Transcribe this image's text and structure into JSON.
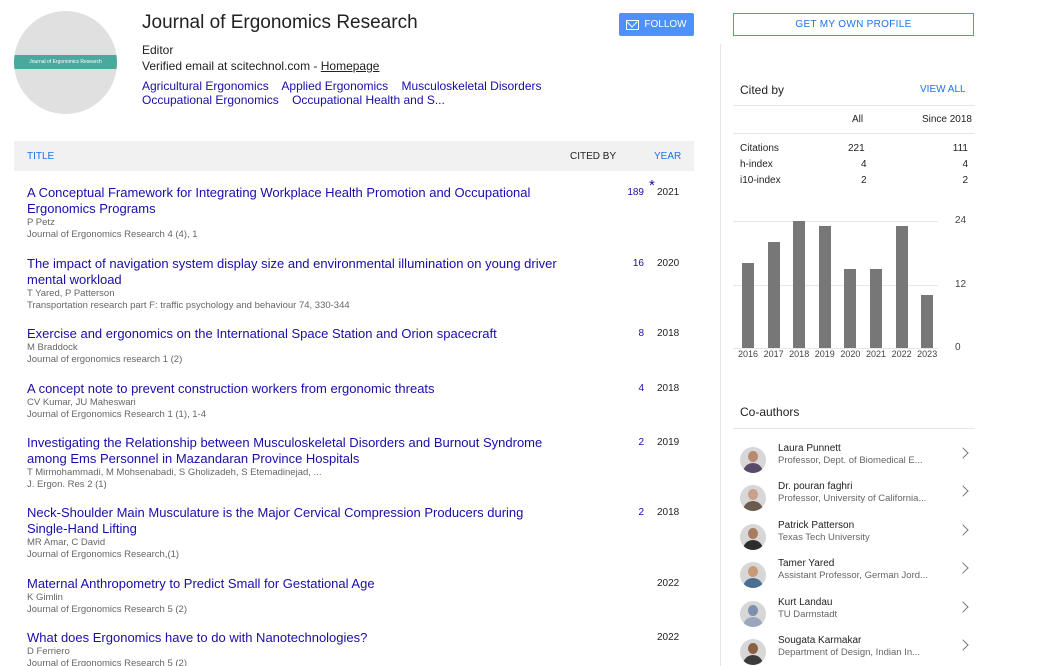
{
  "profile": {
    "name": "Journal of Ergonomics Research",
    "avatar_text": "Journal of Ergonomics Research",
    "affiliation": "Editor",
    "email_text": "Verified email at scitechnol.com - ",
    "homepage_label": "Homepage",
    "interests": [
      "Agricultural Ergonomics",
      "Applied Ergonomics",
      "Musculoskeletal Disorders",
      "Occupational Ergonomics",
      "Occupational Health and S..."
    ]
  },
  "buttons": {
    "follow": "FOLLOW",
    "own_profile": "GET MY OWN PROFILE"
  },
  "table": {
    "col_title": "TITLE",
    "col_cited": "CITED BY",
    "col_year": "YEAR",
    "rows": [
      {
        "title": "A Conceptual Framework for Integrating Workplace Health Promotion and Occupational Ergonomics Programs",
        "authors": "P Petz",
        "pub": "Journal of Ergonomics Research 4 (4), 1",
        "cited": "189",
        "star": "*",
        "year": "2021"
      },
      {
        "title": "The impact of navigation system display size and environmental illumination on young driver mental workload",
        "authors": "T Yared, P Patterson",
        "pub": "Transportation research part F: traffic psychology and behaviour 74, 330-344",
        "cited": "16",
        "year": "2020"
      },
      {
        "title": "Exercise and ergonomics on the International Space Station and Orion spacecraft",
        "authors": "M Braddock",
        "pub": "Journal of ergonomics research 1 (2)",
        "cited": "8",
        "year": "2018"
      },
      {
        "title": "A concept note to prevent construction workers from ergonomic threats",
        "authors": "CV Kumar, JU Maheswari",
        "pub": "Journal of Ergonomics Research 1 (1), 1-4",
        "cited": "4",
        "year": "2018"
      },
      {
        "title": "Investigating the Relationship between Musculoskeletal Disorders and Burnout Syndrome among Ems Personnel in Mazandaran Province Hospitals",
        "authors": "T Mirmohammadi, M Mohsenabadi, S Gholizadeh, S Etemadinejad, ...",
        "pub": "J. Ergon. Res 2 (1)",
        "cited": "2",
        "year": "2019"
      },
      {
        "title": "Neck-Shoulder Main Musculature is the Major Cervical Compression Producers during Single-Hand Lifting",
        "authors": "MR Amar, C David",
        "pub": "Journal of Ergonomics Research,(1)",
        "cited": "2",
        "year": "2018"
      },
      {
        "title": "Maternal Anthropometry to Predict Small for Gestational Age",
        "authors": "K Gimlin",
        "pub": "Journal of Ergonomics Research 5 (2)",
        "cited": "",
        "year": "2022"
      },
      {
        "title": "What does Ergonomics have to do with Nanotechnologies?",
        "authors": "D Ferriero",
        "pub": "Journal of Ergonomics Research 5 (2)",
        "cited": "",
        "year": "2022"
      }
    ]
  },
  "cited_by": {
    "heading": "Cited by",
    "view_all": "VIEW ALL",
    "col_all": "All",
    "col_since": "Since 2018",
    "metrics": [
      {
        "label": "Citations",
        "all": "221",
        "since": "111"
      },
      {
        "label": "h-index",
        "all": "4",
        "since": "4"
      },
      {
        "label": "i10-index",
        "all": "2",
        "since": "2"
      }
    ]
  },
  "chart_data": {
    "type": "bar",
    "categories": [
      "2016",
      "2017",
      "2018",
      "2019",
      "2020",
      "2021",
      "2022",
      "2023"
    ],
    "values": [
      16,
      20,
      24,
      23,
      15,
      15,
      23,
      10
    ],
    "ylim": [
      0,
      24
    ],
    "yticks": [
      "24",
      "12",
      "0"
    ],
    "grid": true,
    "bar_color": "#777777"
  },
  "coauthors": {
    "heading": "Co-authors",
    "items": [
      {
        "name": "Laura Punnett",
        "affiliation": "Professor, Dept. of Biomedical E...",
        "head": "#b98a70",
        "body": "#5a4a6a"
      },
      {
        "name": "Dr. pouran faghri",
        "affiliation": "Professor, University of California...",
        "head": "#c9a08a",
        "body": "#6b5a50"
      },
      {
        "name": "Patrick Patterson",
        "affiliation": "Texas Tech University",
        "head": "#a97c62",
        "body": "#2d2d2d"
      },
      {
        "name": "Tamer Yared",
        "affiliation": "Assistant Professor, German Jord...",
        "head": "#c89a78",
        "body": "#4a6f93"
      },
      {
        "name": "Kurt Landau",
        "affiliation": "TU Darmstadt",
        "head": "#7b8fb0",
        "body": "#9aa6bd"
      },
      {
        "name": "Sougata Karmakar",
        "affiliation": "Department of Design, Indian In...",
        "head": "#8a5f44",
        "body": "#3b3b3b"
      }
    ]
  }
}
